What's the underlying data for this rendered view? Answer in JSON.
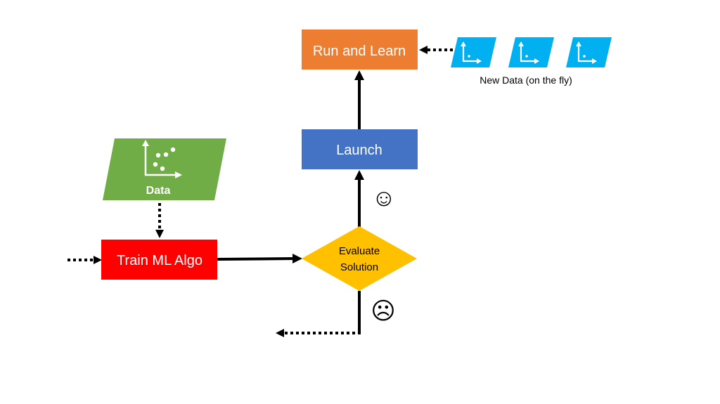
{
  "nodes": {
    "run_learn": {
      "label": "Run and Learn",
      "color": "#ED7D31"
    },
    "launch": {
      "label": "Launch",
      "color": "#4472C4"
    },
    "train": {
      "label": "Train ML Algo",
      "color": "#FF0000"
    },
    "evaluate": {
      "label_line1": "Evaluate",
      "label_line2": "Solution",
      "color": "#FFC000"
    },
    "data": {
      "label": "Data",
      "color": "#70AD47"
    },
    "new_data": {
      "label": "New Data (on the fly)",
      "color": "#00B0F0",
      "count": 3
    }
  },
  "annotations": {
    "success_symbol": "☺",
    "failure_symbol": "☹"
  },
  "edges": [
    {
      "from": "data",
      "to": "train",
      "style": "dotted"
    },
    {
      "from": "external",
      "to": "train",
      "style": "dotted"
    },
    {
      "from": "train",
      "to": "evaluate",
      "style": "solid"
    },
    {
      "from": "evaluate",
      "to": "launch",
      "style": "solid",
      "condition": "success"
    },
    {
      "from": "launch",
      "to": "run_learn",
      "style": "solid"
    },
    {
      "from": "new_data",
      "to": "run_learn",
      "style": "dotted"
    },
    {
      "from": "evaluate",
      "to": "external",
      "style": "dotted",
      "condition": "failure"
    }
  ]
}
